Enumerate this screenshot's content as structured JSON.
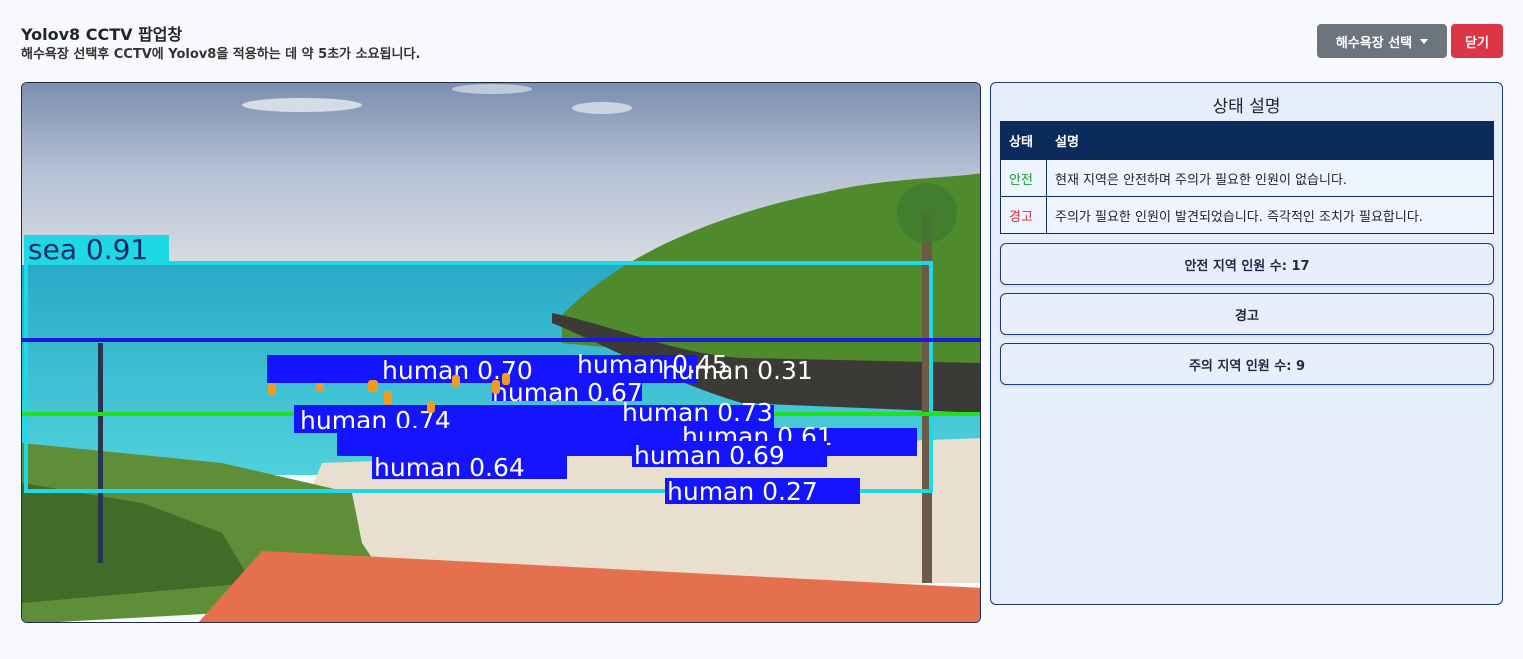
{
  "header": {
    "title": "Yolov8 CCTV 팝업창",
    "subtitle": "해수욕장 선택후 CCTV에 Yolov8을 적용하는 데 약 5초가 소요됩니다."
  },
  "toolbar": {
    "beach_select_label": "해수욕장 선택",
    "close_label": "닫기"
  },
  "video": {
    "sea_label": "sea 0.91",
    "detections": [
      "human 0.70",
      "human 0.67",
      "human 0.45",
      "human 0.31",
      "human 0.74",
      "human 0.73",
      "human 0.61",
      "human 0.27",
      "human 0.64",
      "human 0.69"
    ]
  },
  "panel": {
    "title": "상태 설명",
    "table_headers": [
      "상태",
      "설명"
    ],
    "rows": [
      {
        "status": "안전",
        "desc": "현재 지역은 안전하며 주의가 필요한 인원이 없습니다."
      },
      {
        "status": "경고",
        "desc": "주의가 필요한 인원이 발견되었습니다. 즉각적인 조치가 필요합니다."
      }
    ],
    "safe_count_label": "안전 지역 인원 수: 17",
    "alert_label": "경고",
    "caution_count_label": "주의 지역 인원 수: 9"
  },
  "colors": {
    "sea_box": "#1fd8e6",
    "human_box": "#1414ff",
    "zone_line_blue": "#1a1ad8",
    "zone_line_green": "#22e01a"
  }
}
